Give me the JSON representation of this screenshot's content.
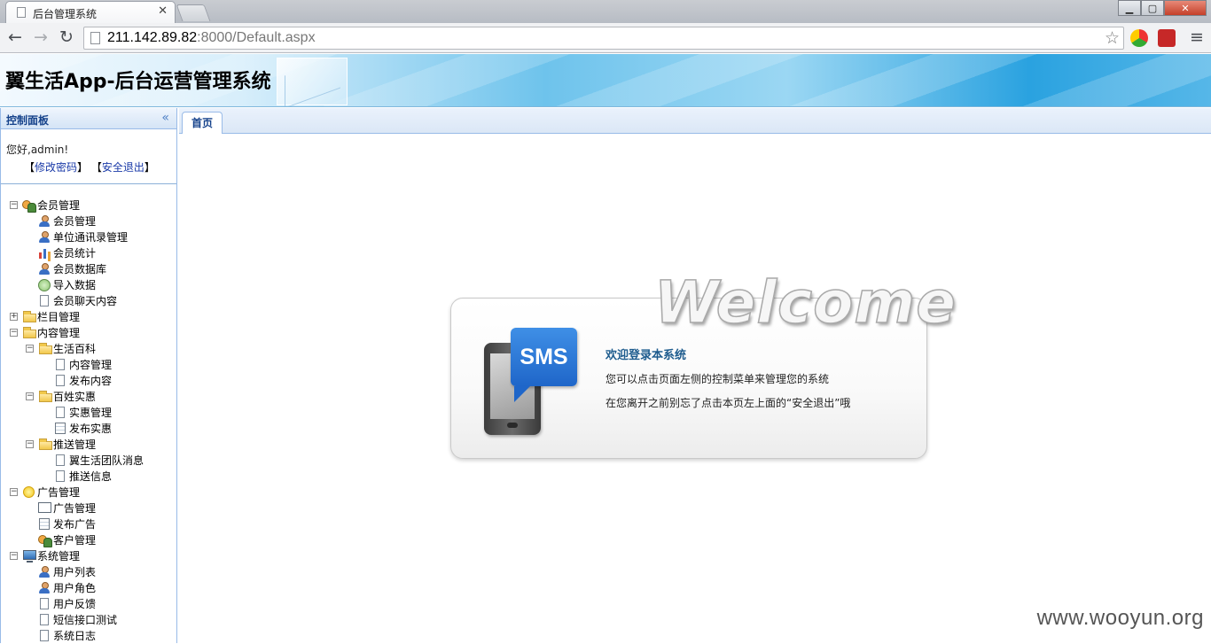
{
  "browser": {
    "tab_title": "后台管理系统",
    "tab_close": "✕",
    "url_host": "211.142.89.82",
    "url_rest": ":8000/Default.aspx",
    "window_buttons": {
      "minimize": "▁",
      "maximize": "▢",
      "close": "✕"
    },
    "nav": {
      "back": "←",
      "forward": "→",
      "reload": "↻",
      "menu": "≡",
      "star": "☆"
    }
  },
  "header": {
    "title": "翼生活App-后台运营管理系统"
  },
  "sidebar": {
    "panel_title": "控制面板",
    "collapse": "«",
    "greeting": "您好,admin!",
    "change_password": "修改密码",
    "logout": "安全退出",
    "tree": [
      {
        "label": "会员管理",
        "toggle": "−",
        "icon": "group-icon"
      },
      {
        "label": "会员管理",
        "icon": "user-icon"
      },
      {
        "label": "单位通讯录管理",
        "icon": "user-icon"
      },
      {
        "label": "会员统计",
        "icon": "chart-icon"
      },
      {
        "label": "会员数据库",
        "icon": "user-icon"
      },
      {
        "label": "导入数据",
        "icon": "import-icon"
      },
      {
        "label": "会员聊天内容",
        "icon": "document-icon"
      },
      {
        "label": "栏目管理",
        "toggle": "+",
        "icon": "folder-icon"
      },
      {
        "label": "内容管理",
        "toggle": "−",
        "icon": "folder-open-icon"
      },
      {
        "label": "生活百科",
        "toggle": "−",
        "icon": "folder-icon"
      },
      {
        "label": "内容管理",
        "icon": "document-icon"
      },
      {
        "label": "发布内容",
        "icon": "document-icon"
      },
      {
        "label": "百姓实惠",
        "toggle": "−",
        "icon": "folder-icon"
      },
      {
        "label": "实惠管理",
        "icon": "document-icon"
      },
      {
        "label": "发布实惠",
        "icon": "form-icon"
      },
      {
        "label": "推送管理",
        "toggle": "−",
        "icon": "folder-icon"
      },
      {
        "label": "翼生活团队消息",
        "icon": "document-icon"
      },
      {
        "label": "推送信息",
        "icon": "document-icon"
      },
      {
        "label": "广告管理",
        "toggle": "−",
        "icon": "sun-icon"
      },
      {
        "label": "广告管理",
        "icon": "screen-icon"
      },
      {
        "label": "发布广告",
        "icon": "form-icon"
      },
      {
        "label": "客户管理",
        "icon": "group-icon"
      },
      {
        "label": "系统管理",
        "toggle": "−",
        "icon": "monitor-icon"
      },
      {
        "label": "用户列表",
        "icon": "user-icon"
      },
      {
        "label": "用户角色",
        "icon": "user-icon"
      },
      {
        "label": "用户反馈",
        "icon": "document-icon"
      },
      {
        "label": "短信接口测试",
        "icon": "document-icon"
      },
      {
        "label": "系统日志",
        "icon": "document-icon"
      }
    ]
  },
  "main": {
    "tab_home": "首页",
    "welcome_word": "Welcome",
    "sms_label": "SMS",
    "welcome_heading": "欢迎登录本系统",
    "welcome_line1": "您可以点击页面左侧的控制菜单来管理您的系统",
    "welcome_line2": "在您离开之前别忘了点击本页左上面的“安全退出”哦"
  },
  "watermark": "www.wooyun.org"
}
